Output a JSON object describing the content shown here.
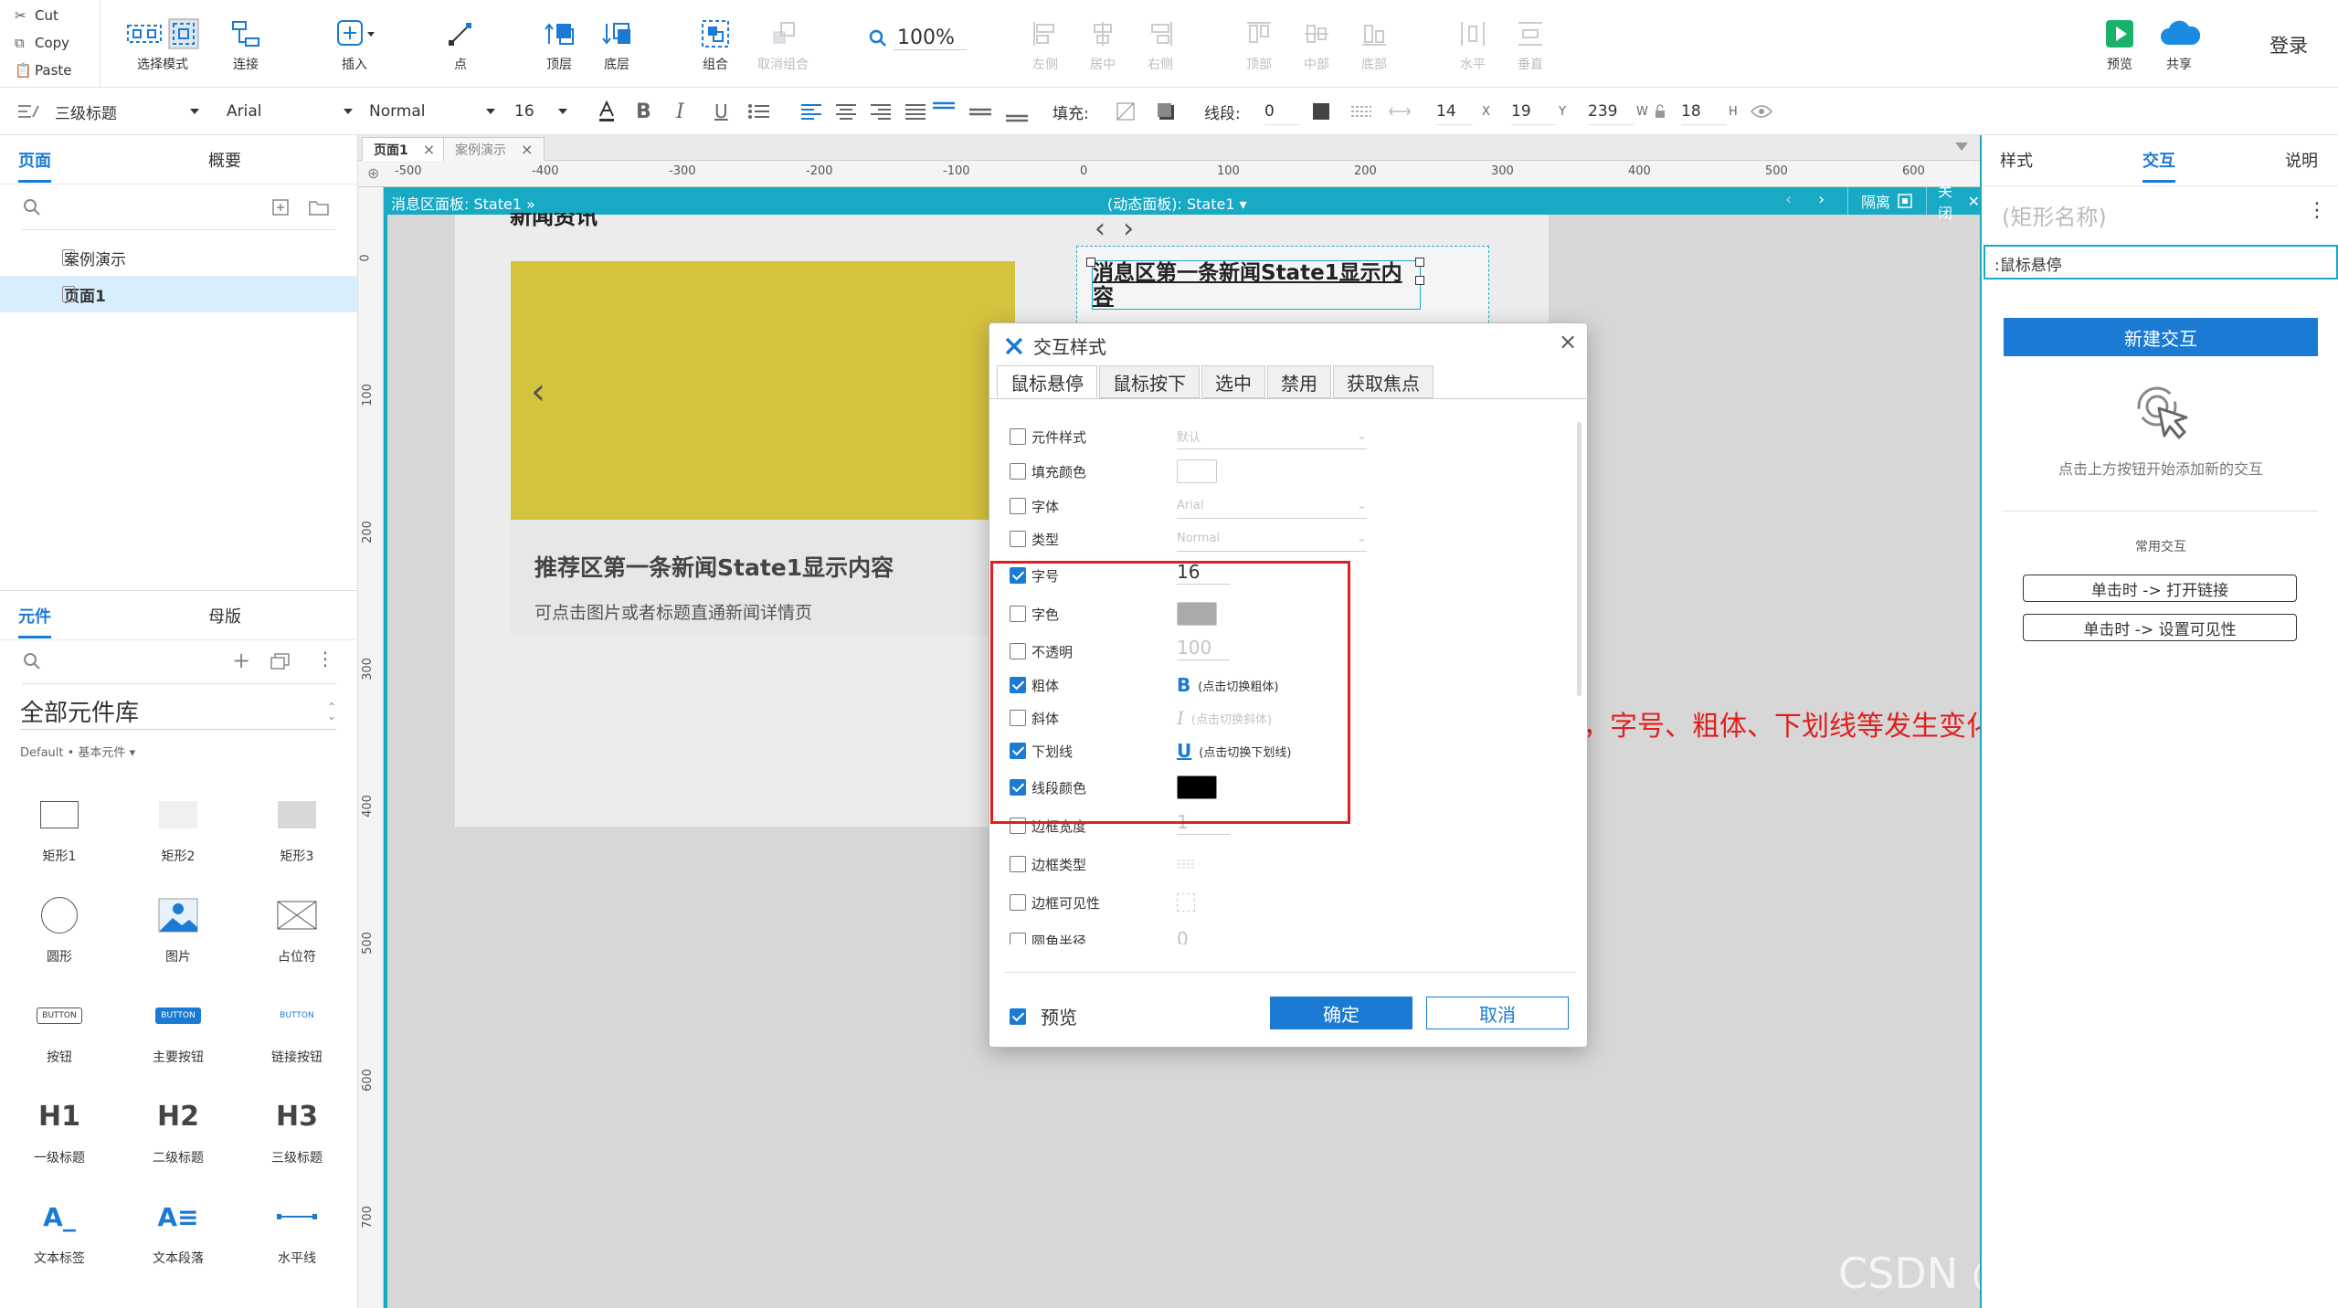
{
  "clipboard": {
    "cut": "Cut",
    "copy": "Copy",
    "paste": "Paste"
  },
  "toolbar": {
    "select_mode": "选择模式",
    "connect": "连接",
    "insert": "插入",
    "point": "点",
    "top_layer": "顶层",
    "bottom_layer": "底层",
    "group": "组合",
    "ungroup": "取消组合",
    "zoom": "100%",
    "align_left": "左侧",
    "align_center": "居中",
    "align_right": "右侧",
    "align_top": "顶部",
    "align_middle": "中部",
    "align_bottom": "底部",
    "dist_horizontal": "水平",
    "dist_vertical": "垂直",
    "preview": "预览",
    "share": "共享",
    "login": "登录"
  },
  "format": {
    "style": "三级标题",
    "font": "Arial",
    "weight": "Normal",
    "size": "16",
    "bold": "B",
    "italic": "I",
    "underline": "U",
    "fill_label": "填充:",
    "line_label": "线段:",
    "line_value": "0",
    "x": "14",
    "x_label": "X",
    "y": "19",
    "y_label": "Y",
    "w": "239",
    "w_label": "W",
    "h": "18",
    "h_label": "H"
  },
  "left_panel": {
    "tab_pages": "页面",
    "tab_overview": "概要",
    "pages": [
      {
        "label": "案例演示",
        "selected": false
      },
      {
        "label": "页面1",
        "selected": true
      }
    ],
    "tab_widgets": "元件",
    "tab_masters": "母版",
    "library": "全部元件库",
    "breadcrumb": "Default • 基本元件 ▾",
    "widgets": [
      {
        "label": "矩形1"
      },
      {
        "label": "矩形2"
      },
      {
        "label": "矩形3"
      },
      {
        "label": "圆形"
      },
      {
        "label": "图片"
      },
      {
        "label": "占位符"
      },
      {
        "label": "按钮",
        "glyph": "BUTTON"
      },
      {
        "label": "主要按钮",
        "glyph": "BUTTON"
      },
      {
        "label": "链接按钮",
        "glyph": "BUTTON"
      },
      {
        "label": "一级标题",
        "glyph": "H1"
      },
      {
        "label": "二级标题",
        "glyph": "H2"
      },
      {
        "label": "三级标题",
        "glyph": "H3"
      },
      {
        "label": "文本标签",
        "glyph": "A_"
      },
      {
        "label": "文本段落",
        "glyph": "A≡"
      },
      {
        "label": "水平线"
      }
    ]
  },
  "canvas": {
    "doc_tabs": [
      {
        "label": "页面1",
        "active": true
      },
      {
        "label": "案例演示",
        "active": false
      }
    ],
    "ruler_h": [
      "-500",
      "-400",
      "-300",
      "-200",
      "-100",
      "0",
      "100",
      "200",
      "300",
      "400",
      "500",
      "600"
    ],
    "ruler_v": [
      "0",
      "100",
      "200",
      "300",
      "400",
      "500",
      "600",
      "700"
    ],
    "panel_path": "消息区面板: State1",
    "panel_state": "(动态面板): State1",
    "isolate": "隔离",
    "close": "关闭",
    "news_header": "新闻资讯",
    "card_title": "推荐区第一条新闻State1显示内容",
    "card_desc": "可点击图片或者标题直通新闻详情页",
    "selected_text": "消息区第一条新闻State1显示内容",
    "annotation": "当鼠标悬停时，字号、粗体、下划线等发生变化",
    "watermark": "CSDN @结构化知识课堂"
  },
  "right_panel": {
    "tab_style": "样式",
    "tab_interact": "交互",
    "tab_notes": "说明",
    "shape_name": "(矩形名称)",
    "event_field": ":鼠标悬停",
    "new_interaction": "新建交互",
    "hint": "点击上方按钮开始添加新的交互",
    "common": "常用交互",
    "quick": [
      "单击时 -> 打开链接",
      "单击时 -> 设置可见性"
    ]
  },
  "dialog": {
    "title": "交互样式",
    "tabs": [
      "鼠标悬停",
      "鼠标按下",
      "选中",
      "禁用",
      "获取焦点"
    ],
    "props": [
      {
        "label": "元件样式",
        "checked": false,
        "value": "默认"
      },
      {
        "label": "填充颜色",
        "checked": false
      },
      {
        "label": "字体",
        "checked": false,
        "value": "Arial"
      },
      {
        "label": "类型",
        "checked": false,
        "value": "Normal"
      },
      {
        "label": "字号",
        "checked": true,
        "value": "16"
      },
      {
        "label": "字色",
        "checked": false
      },
      {
        "label": "不透明",
        "checked": false,
        "value": "100"
      },
      {
        "label": "粗体",
        "checked": true,
        "value": "(点击切换粗体)",
        "glyph": "B"
      },
      {
        "label": "斜体",
        "checked": false,
        "value": "(点击切换斜体)",
        "glyph": "I"
      },
      {
        "label": "下划线",
        "checked": true,
        "value": "(点击切换下划线)",
        "glyph": "U"
      },
      {
        "label": "线段颜色",
        "checked": true
      },
      {
        "label": "边框宽度",
        "checked": false,
        "value": "1"
      },
      {
        "label": "边框类型",
        "checked": false
      },
      {
        "label": "边框可见性",
        "checked": false
      },
      {
        "label": "圆角半径",
        "checked": false,
        "value": "0"
      }
    ],
    "preview": "预览",
    "ok": "确定",
    "cancel": "取消"
  },
  "colors": {
    "accent": "#1a7ad4",
    "panel": "#18a9c5",
    "highlight": "#e02020",
    "yellow": "#d4c33d"
  }
}
